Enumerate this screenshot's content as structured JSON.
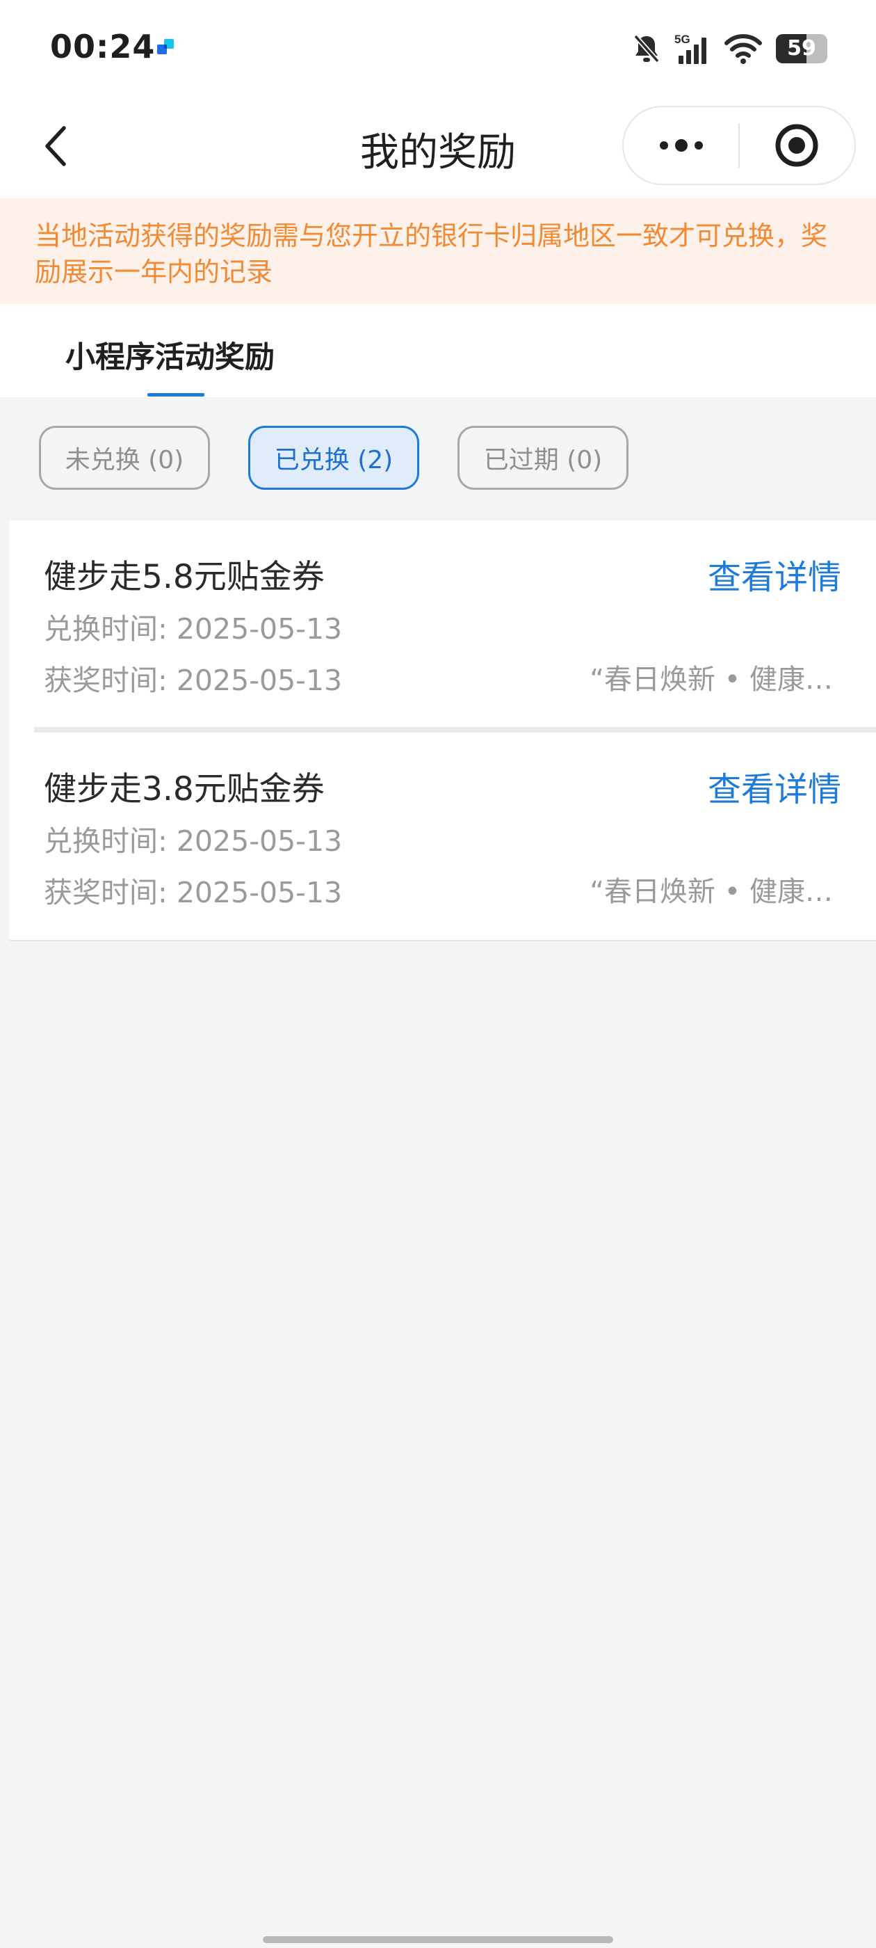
{
  "status_bar": {
    "time": "00:24",
    "battery_level": "59",
    "icons": [
      "app-notification-icon",
      "bell-muted-icon",
      "signal-5g-icon",
      "wifi-icon",
      "battery-icon"
    ]
  },
  "nav": {
    "title": "我的奖励",
    "icons": [
      "back-icon",
      "more-icon",
      "close-target-icon"
    ]
  },
  "notice": {
    "text": "当地活动获得的奖励需与您开立的银行卡归属地区一致才可兑换，奖励展示一年内的记录"
  },
  "tabs": [
    {
      "label": "小程序活动奖励",
      "selected": true
    }
  ],
  "filters": [
    {
      "label": "未兑换 (0)",
      "selected": false
    },
    {
      "label": "已兑换 (2)",
      "selected": true
    },
    {
      "label": "已过期 (0)",
      "selected": false
    }
  ],
  "rewards": [
    {
      "title": "健步走5.8元贴金券",
      "detail_link": "查看详情",
      "redeem_time": "兑换时间: 2025-05-13",
      "award_time": "获奖时间: 2025-05-13",
      "activity": "“春日焕新 • 健康…"
    },
    {
      "title": "健步走3.8元贴金券",
      "detail_link": "查看详情",
      "redeem_time": "兑换时间: 2025-05-13",
      "award_time": "获奖时间: 2025-05-13",
      "activity": "“春日焕新 • 健康…"
    }
  ],
  "colors": {
    "accent_blue": "#1f7bd8",
    "notice_text": "#f08a35",
    "notice_bg": "#fdf1e9",
    "page_bg": "#f3f4f6"
  }
}
